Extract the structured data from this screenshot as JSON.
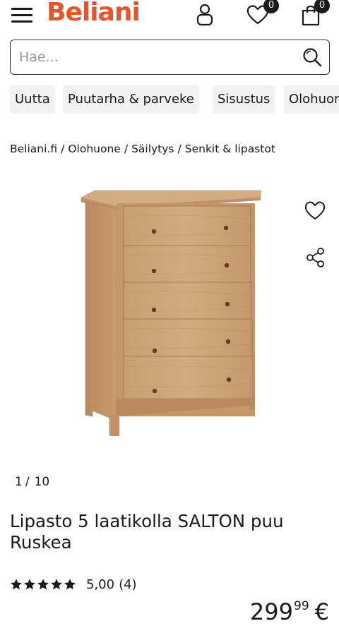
{
  "header": {
    "logo_text": "Beliani",
    "brand_color": "#e8542e",
    "wishlist_count": "0",
    "cart_count": "0",
    "icons": [
      "hamburger-icon",
      "user-icon",
      "heart-icon",
      "bag-icon"
    ]
  },
  "search": {
    "placeholder": "Hae...",
    "value": ""
  },
  "categories": [
    "Uutta",
    "Puutarha & parveke",
    "Sisustus",
    "Olohuone"
  ],
  "breadcrumb": [
    "Beliani.fi",
    "Olohuone",
    "Säilytys",
    "Senkit & lipastot"
  ],
  "gallery": {
    "current": "1",
    "total": "10"
  },
  "product": {
    "title": "Lipasto 5 laatikolla SALTON puu Ruskea",
    "rating_value": 5.0,
    "rating_text": "5,00",
    "review_count": "(4)",
    "price_whole": "299",
    "price_cents": "99",
    "currency": "€"
  }
}
